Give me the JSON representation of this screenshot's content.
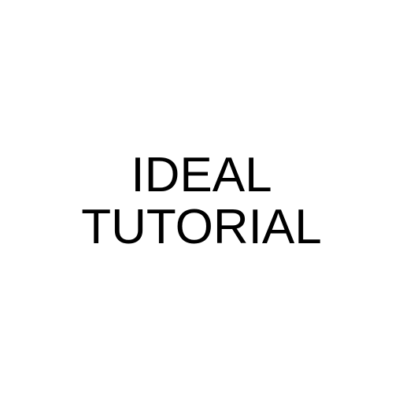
{
  "title": {
    "line1": "IDEAL",
    "line2": "TUTORIAL"
  },
  "colors": {
    "background": "#ffffff",
    "text": "#000000"
  }
}
